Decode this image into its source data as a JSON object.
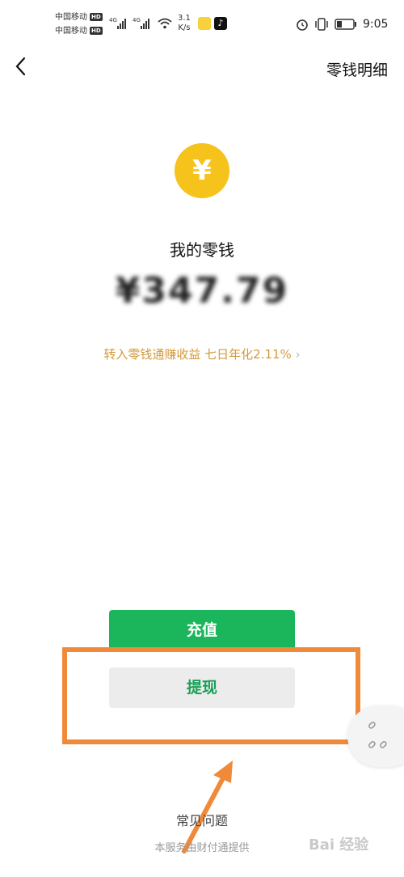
{
  "status_bar": {
    "carrier_1": "中国移动",
    "carrier_2": "中国移动",
    "hd_badge": "HD",
    "network": "4G",
    "speed_value": "3.1",
    "speed_unit": "K/s",
    "time": "9:05",
    "icons": [
      "signal-icon",
      "wifi-icon",
      "app-icon",
      "tiktok-icon",
      "alarm-icon",
      "vibrate-icon",
      "battery-icon"
    ]
  },
  "header": {
    "back_icon": "chevron-left-icon",
    "detail_link": "零钱明细"
  },
  "wallet": {
    "coin_symbol": "¥",
    "title": "我的零钱",
    "amount": "¥347.79",
    "promo": "转入零钱通赚收益 七日年化2.11%",
    "promo_chevron": "›"
  },
  "actions": {
    "recharge_label": "充值",
    "withdraw_label": "提现"
  },
  "footer": {
    "faq": "常见问题",
    "provider": "本服务由财付通提供"
  },
  "watermark": "Bai 经验",
  "colors": {
    "coin": "#f6c21c",
    "recharge_bg": "#1bb55c",
    "withdraw_text": "#1aa057",
    "promo": "#d49a3a",
    "highlight": "#f08a3b"
  }
}
